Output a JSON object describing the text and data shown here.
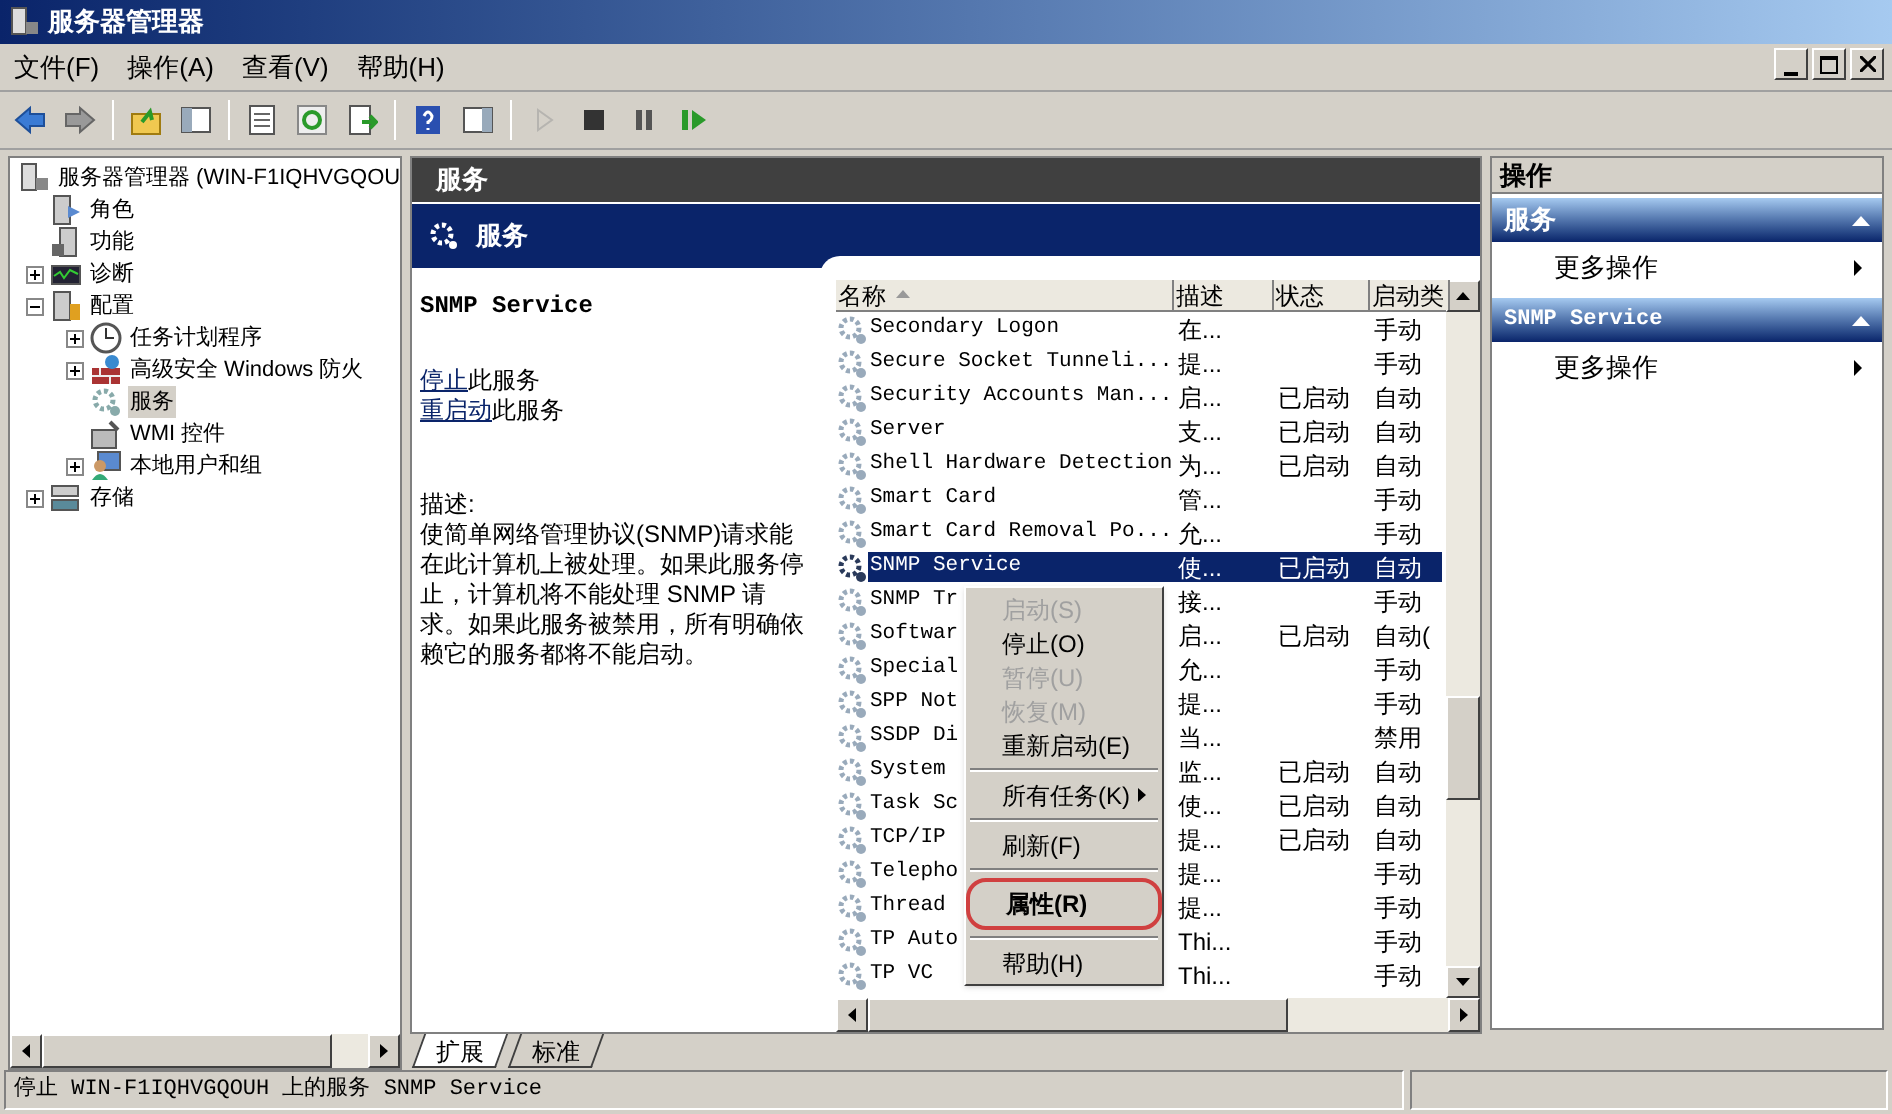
{
  "window": {
    "title": "服务器管理器"
  },
  "menu_bar": [
    "文件(F)",
    "操作(A)",
    "查看(V)",
    "帮助(H)"
  ],
  "toolbar": [
    {
      "kind": "back",
      "disabled": false
    },
    {
      "kind": "forward",
      "disabled": false
    },
    {
      "kind": "sep"
    },
    {
      "kind": "up",
      "disabled": false
    },
    {
      "kind": "tree",
      "disabled": false
    },
    {
      "kind": "sep"
    },
    {
      "kind": "props",
      "disabled": false
    },
    {
      "kind": "refresh",
      "disabled": false
    },
    {
      "kind": "export",
      "disabled": false
    },
    {
      "kind": "sep"
    },
    {
      "kind": "help",
      "disabled": false
    },
    {
      "kind": "pane",
      "disabled": false
    },
    {
      "kind": "sep"
    },
    {
      "kind": "play",
      "disabled": true
    },
    {
      "kind": "stop",
      "disabled": false
    },
    {
      "kind": "pause",
      "disabled": false
    },
    {
      "kind": "resume",
      "disabled": false
    }
  ],
  "tree": [
    {
      "label": "服务器管理器 (WIN-F1IQHVGQOU",
      "selected": false,
      "children": [
        {
          "label": "角色",
          "selected": false
        },
        {
          "label": "功能",
          "selected": false
        },
        {
          "label": "诊断",
          "selected": false,
          "expanded": false
        },
        {
          "label": "配置",
          "selected": false,
          "expanded": true,
          "children": [
            {
              "label": "任务计划程序",
              "selected": false,
              "expanded": false
            },
            {
              "label": "高级安全 Windows 防火",
              "selected": false,
              "expanded": false
            },
            {
              "label": "服务",
              "selected": true
            },
            {
              "label": "WMI 控件",
              "selected": false
            },
            {
              "label": "本地用户和组",
              "selected": false,
              "expanded": false
            }
          ]
        },
        {
          "label": "存储",
          "selected": false,
          "expanded": false
        }
      ]
    }
  ],
  "center": {
    "header": "服务",
    "banner": "服务",
    "detail": {
      "service_name": "SNMP Service",
      "links": [
        {
          "link": "停止",
          "rest": "此服务"
        },
        {
          "link": "重启动",
          "rest": "此服务"
        }
      ],
      "description_label": "描述:",
      "description": "使简单网络管理协议(SNMP)请求能在此计算机上被处理。如果此服务停止，计算机将不能处理 SNMP 请求。如果此服务被禁用，所有明确依赖它的服务都将不能启动。"
    },
    "table": {
      "columns": [
        {
          "label": "名称",
          "sorted": true
        },
        {
          "label": "描述",
          "sorted": false
        },
        {
          "label": "状态",
          "sorted": false
        },
        {
          "label": "启动类",
          "sorted": false
        }
      ],
      "rows": [
        {
          "name": "Secondary Logon",
          "desc": "在...",
          "status": "",
          "startup": "手动",
          "selected": false
        },
        {
          "name": "Secure Socket Tunneli...",
          "desc": "提...",
          "status": "",
          "startup": "手动",
          "selected": false
        },
        {
          "name": "Security Accounts Man...",
          "desc": "启...",
          "status": "已启动",
          "startup": "自动",
          "selected": false
        },
        {
          "name": "Server",
          "desc": "支...",
          "status": "已启动",
          "startup": "自动",
          "selected": false
        },
        {
          "name": "Shell Hardware Detection",
          "desc": "为...",
          "status": "已启动",
          "startup": "自动",
          "selected": false
        },
        {
          "name": "Smart Card",
          "desc": "管...",
          "status": "",
          "startup": "手动",
          "selected": false
        },
        {
          "name": "Smart Card Removal Po...",
          "desc": "允...",
          "status": "",
          "startup": "手动",
          "selected": false
        },
        {
          "name": "SNMP Service",
          "desc": "使...",
          "status": "已启动",
          "startup": "自动",
          "selected": true
        },
        {
          "name": "SNMP Tr",
          "desc": "接...",
          "status": "",
          "startup": "手动",
          "selected": false
        },
        {
          "name": "Softwar",
          "desc": "启...",
          "status": "已启动",
          "startup": "自动(",
          "selected": false
        },
        {
          "name": "Special",
          "desc": "允...",
          "status": "",
          "startup": "手动",
          "selected": false
        },
        {
          "name": "SPP Not",
          "desc": "提...",
          "status": "",
          "startup": "手动",
          "selected": false
        },
        {
          "name": "SSDP Di",
          "desc": "当...",
          "status": "",
          "startup": "禁用",
          "selected": false
        },
        {
          "name": "System",
          "desc": "监...",
          "status": "已启动",
          "startup": "自动",
          "selected": false
        },
        {
          "name": "Task Sc",
          "desc": "使...",
          "status": "已启动",
          "startup": "自动",
          "selected": false
        },
        {
          "name": "TCP/IP",
          "desc": "提...",
          "status": "已启动",
          "startup": "自动",
          "selected": false
        },
        {
          "name": "Telepho",
          "desc": "提...",
          "status": "",
          "startup": "手动",
          "selected": false
        },
        {
          "name": "Thread",
          "desc": "提...",
          "status": "",
          "startup": "手动",
          "selected": false
        },
        {
          "name": "TP Auto",
          "desc": "Thi...",
          "status": "",
          "startup": "手动",
          "selected": false
        },
        {
          "name": "TP VC",
          "desc": "Thi...",
          "status": "",
          "startup": "手动",
          "selected": false
        }
      ]
    },
    "tabs": [
      {
        "label": "扩展",
        "selected": true
      },
      {
        "label": "标准",
        "selected": false
      }
    ]
  },
  "context_menu": [
    {
      "kind": "item",
      "label": "启动(S)",
      "disabled": true
    },
    {
      "kind": "item",
      "label": "停止(O)",
      "disabled": false
    },
    {
      "kind": "item",
      "label": "暂停(U)",
      "disabled": true
    },
    {
      "kind": "item",
      "label": "恢复(M)",
      "disabled": true
    },
    {
      "kind": "item",
      "label": "重新启动(E)",
      "disabled": false
    },
    {
      "kind": "sep"
    },
    {
      "kind": "submenu",
      "label": "所有任务(K)",
      "disabled": false
    },
    {
      "kind": "sep"
    },
    {
      "kind": "item",
      "label": "刷新(F)",
      "disabled": false
    },
    {
      "kind": "sep"
    },
    {
      "kind": "default",
      "label": "属性(R)",
      "disabled": false,
      "circled": true
    },
    {
      "kind": "sep"
    },
    {
      "kind": "item",
      "label": "帮助(H)",
      "disabled": false
    }
  ],
  "actions": {
    "header": "操作",
    "sections": [
      {
        "title": "服务",
        "expanded": true,
        "items": [
          "更多操作"
        ]
      },
      {
        "title": "SNMP Service",
        "expanded": true,
        "items": [
          "更多操作"
        ]
      }
    ]
  },
  "status_bar": "停止 WIN-F1IQHVGQOUH 上的服务 SNMP Service"
}
